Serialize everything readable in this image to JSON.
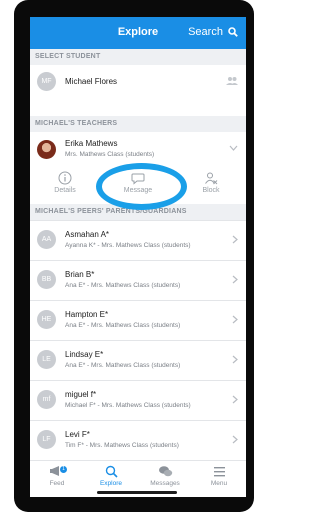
{
  "header": {
    "title": "Explore",
    "search_label": "Search"
  },
  "select_student": {
    "section_label": "SELECT STUDENT",
    "initials": "MF",
    "name": "Michael Flores"
  },
  "teachers": {
    "section_label": "MICHAEL'S TEACHERS",
    "name": "Erika Mathews",
    "subtitle": "Mrs. Mathews Class (students)",
    "actions": {
      "details": "Details",
      "message": "Message",
      "block": "Block"
    }
  },
  "peers": {
    "section_label": "MICHAEL'S PEERS' PARENTS/GUARDIANS",
    "items": [
      {
        "initials": "AA",
        "name": "Asmahan A*",
        "sub": "Ayanna K* - Mrs. Mathews Class (students)"
      },
      {
        "initials": "BB",
        "name": "Brian B*",
        "sub": "Ana E* - Mrs. Mathews Class (students)"
      },
      {
        "initials": "HE",
        "name": "Hampton E*",
        "sub": "Ana E* - Mrs. Mathews Class (students)"
      },
      {
        "initials": "LE",
        "name": "Lindsay E*",
        "sub": "Ana E* - Mrs. Mathews Class (students)"
      },
      {
        "initials": "mf",
        "name": "miguel f*",
        "sub": "Michael F* - Mrs. Mathews Class (students)"
      },
      {
        "initials": "LF",
        "name": "Levi F*",
        "sub": "Tim F* - Mrs. Mathews Class (students)"
      }
    ]
  },
  "bottom_nav": {
    "feed": "Feed",
    "feed_badge": "1",
    "explore": "Explore",
    "messages": "Messages",
    "menu": "Menu"
  },
  "colors": {
    "accent": "#1a8ee5",
    "annotation": "#1a9fe8"
  }
}
